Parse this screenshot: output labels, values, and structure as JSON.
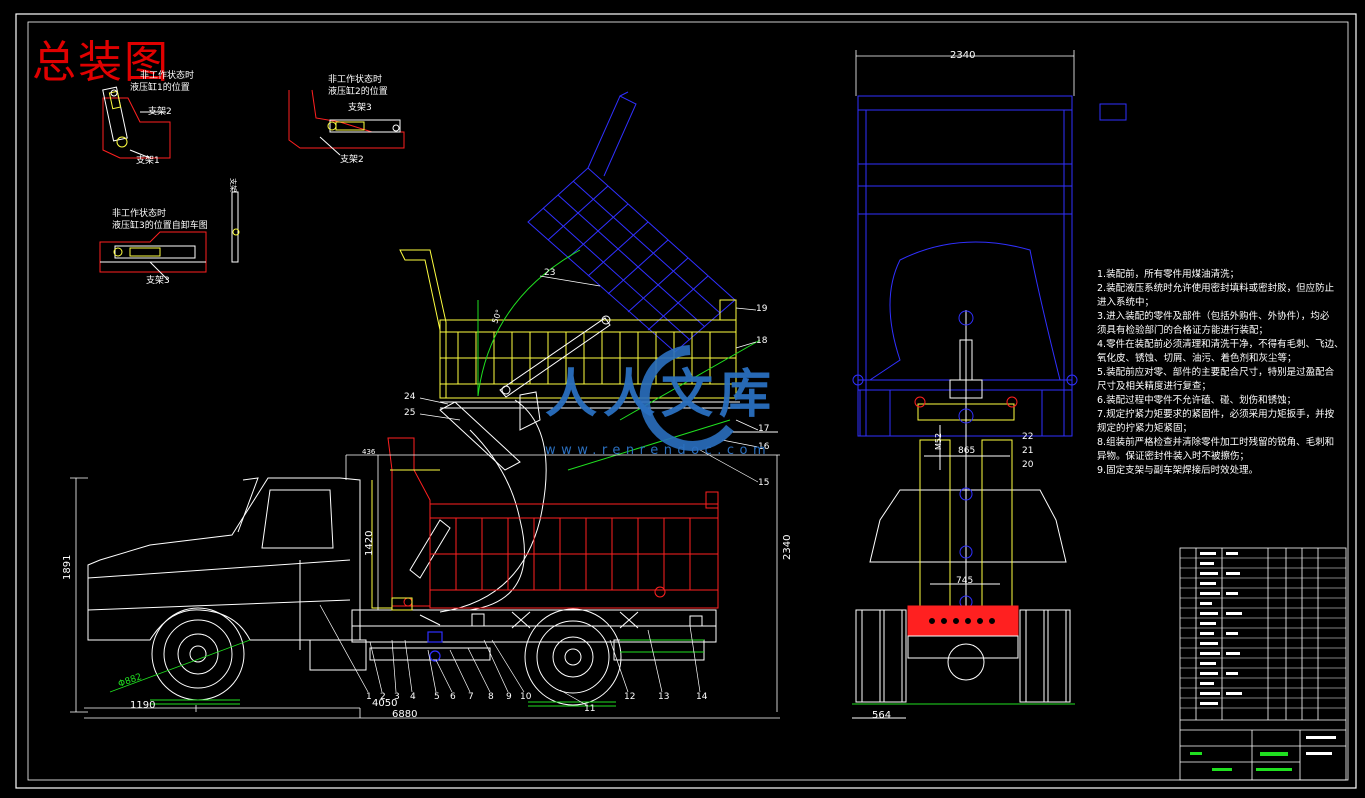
{
  "drawing": {
    "title": "总装图",
    "colors": {
      "frame": "#ffffff",
      "red": "#ff2020",
      "yellow": "#ffff40",
      "blue": "#3030ff",
      "green": "#20e020",
      "cyan": "#40e0ff",
      "watermark": "#2a6fbf"
    }
  },
  "details": {
    "d1_note1": "非工作状态时",
    "d1_note2": "液压缸1的位置",
    "d1_sup2": "支架2",
    "d1_sup1": "支架1",
    "d2_note1": "非工作状态时",
    "d2_note2": "液压缸2的位置",
    "d2_sup3": "支架3",
    "d2_sup2": "支架2",
    "d3_note1": "非工作状态时",
    "d3_note2": "液压缸3的位置自卸车图",
    "d3_sup3": "支架3",
    "vert_label": "支架"
  },
  "dims": {
    "d2340_top": "2340",
    "d2340_side": "2340",
    "d1891": "1891",
    "d1420": "1420",
    "d4050": "4050",
    "d6880": "6880",
    "d1190": "1190",
    "d882": "Φ882",
    "d436": "436",
    "d745": "745",
    "d865": "865",
    "d564": "564",
    "dM52": "M52",
    "d50": "50°"
  },
  "balloons": [
    "1",
    "2",
    "3",
    "4",
    "5",
    "6",
    "7",
    "8",
    "9",
    "10",
    "11",
    "12",
    "13",
    "14",
    "15",
    "16",
    "17",
    "18",
    "19",
    "20",
    "21",
    "22",
    "23",
    "24",
    "25"
  ],
  "notes": [
    "1.装配前，所有零件用煤油清洗；",
    "2.装配液压系统时允许使用密封填料或密封胶，但应防止",
    "  进入系统中；",
    "3.进入装配的零件及部件（包括外购件、外协件），均必",
    "  须具有检验部门的合格证方能进行装配；",
    "4.零件在装配前必须清理和清洗干净，不得有毛刺、飞边、",
    "  氧化皮、锈蚀、切屑、油污、着色剂和灰尘等；",
    "5.装配前应对零、部件的主要配合尺寸，特别是过盈配合",
    "  尺寸及相关精度进行复查；",
    "6.装配过程中零件不允许磕、碰、划伤和锈蚀；",
    "7.规定拧紧力矩要求的紧固件，必须采用力矩扳手，并按",
    "  规定的拧紧力矩紧固；",
    "8.组装前严格检查并清除零件加工时残留的锐角、毛刺和",
    "  异物。保证密封件装入时不被擦伤；",
    "9.固定支架与副车架焊接后时效处理。"
  ],
  "watermark": {
    "cn": "人人文库",
    "url": "www.renrendoc.com"
  }
}
